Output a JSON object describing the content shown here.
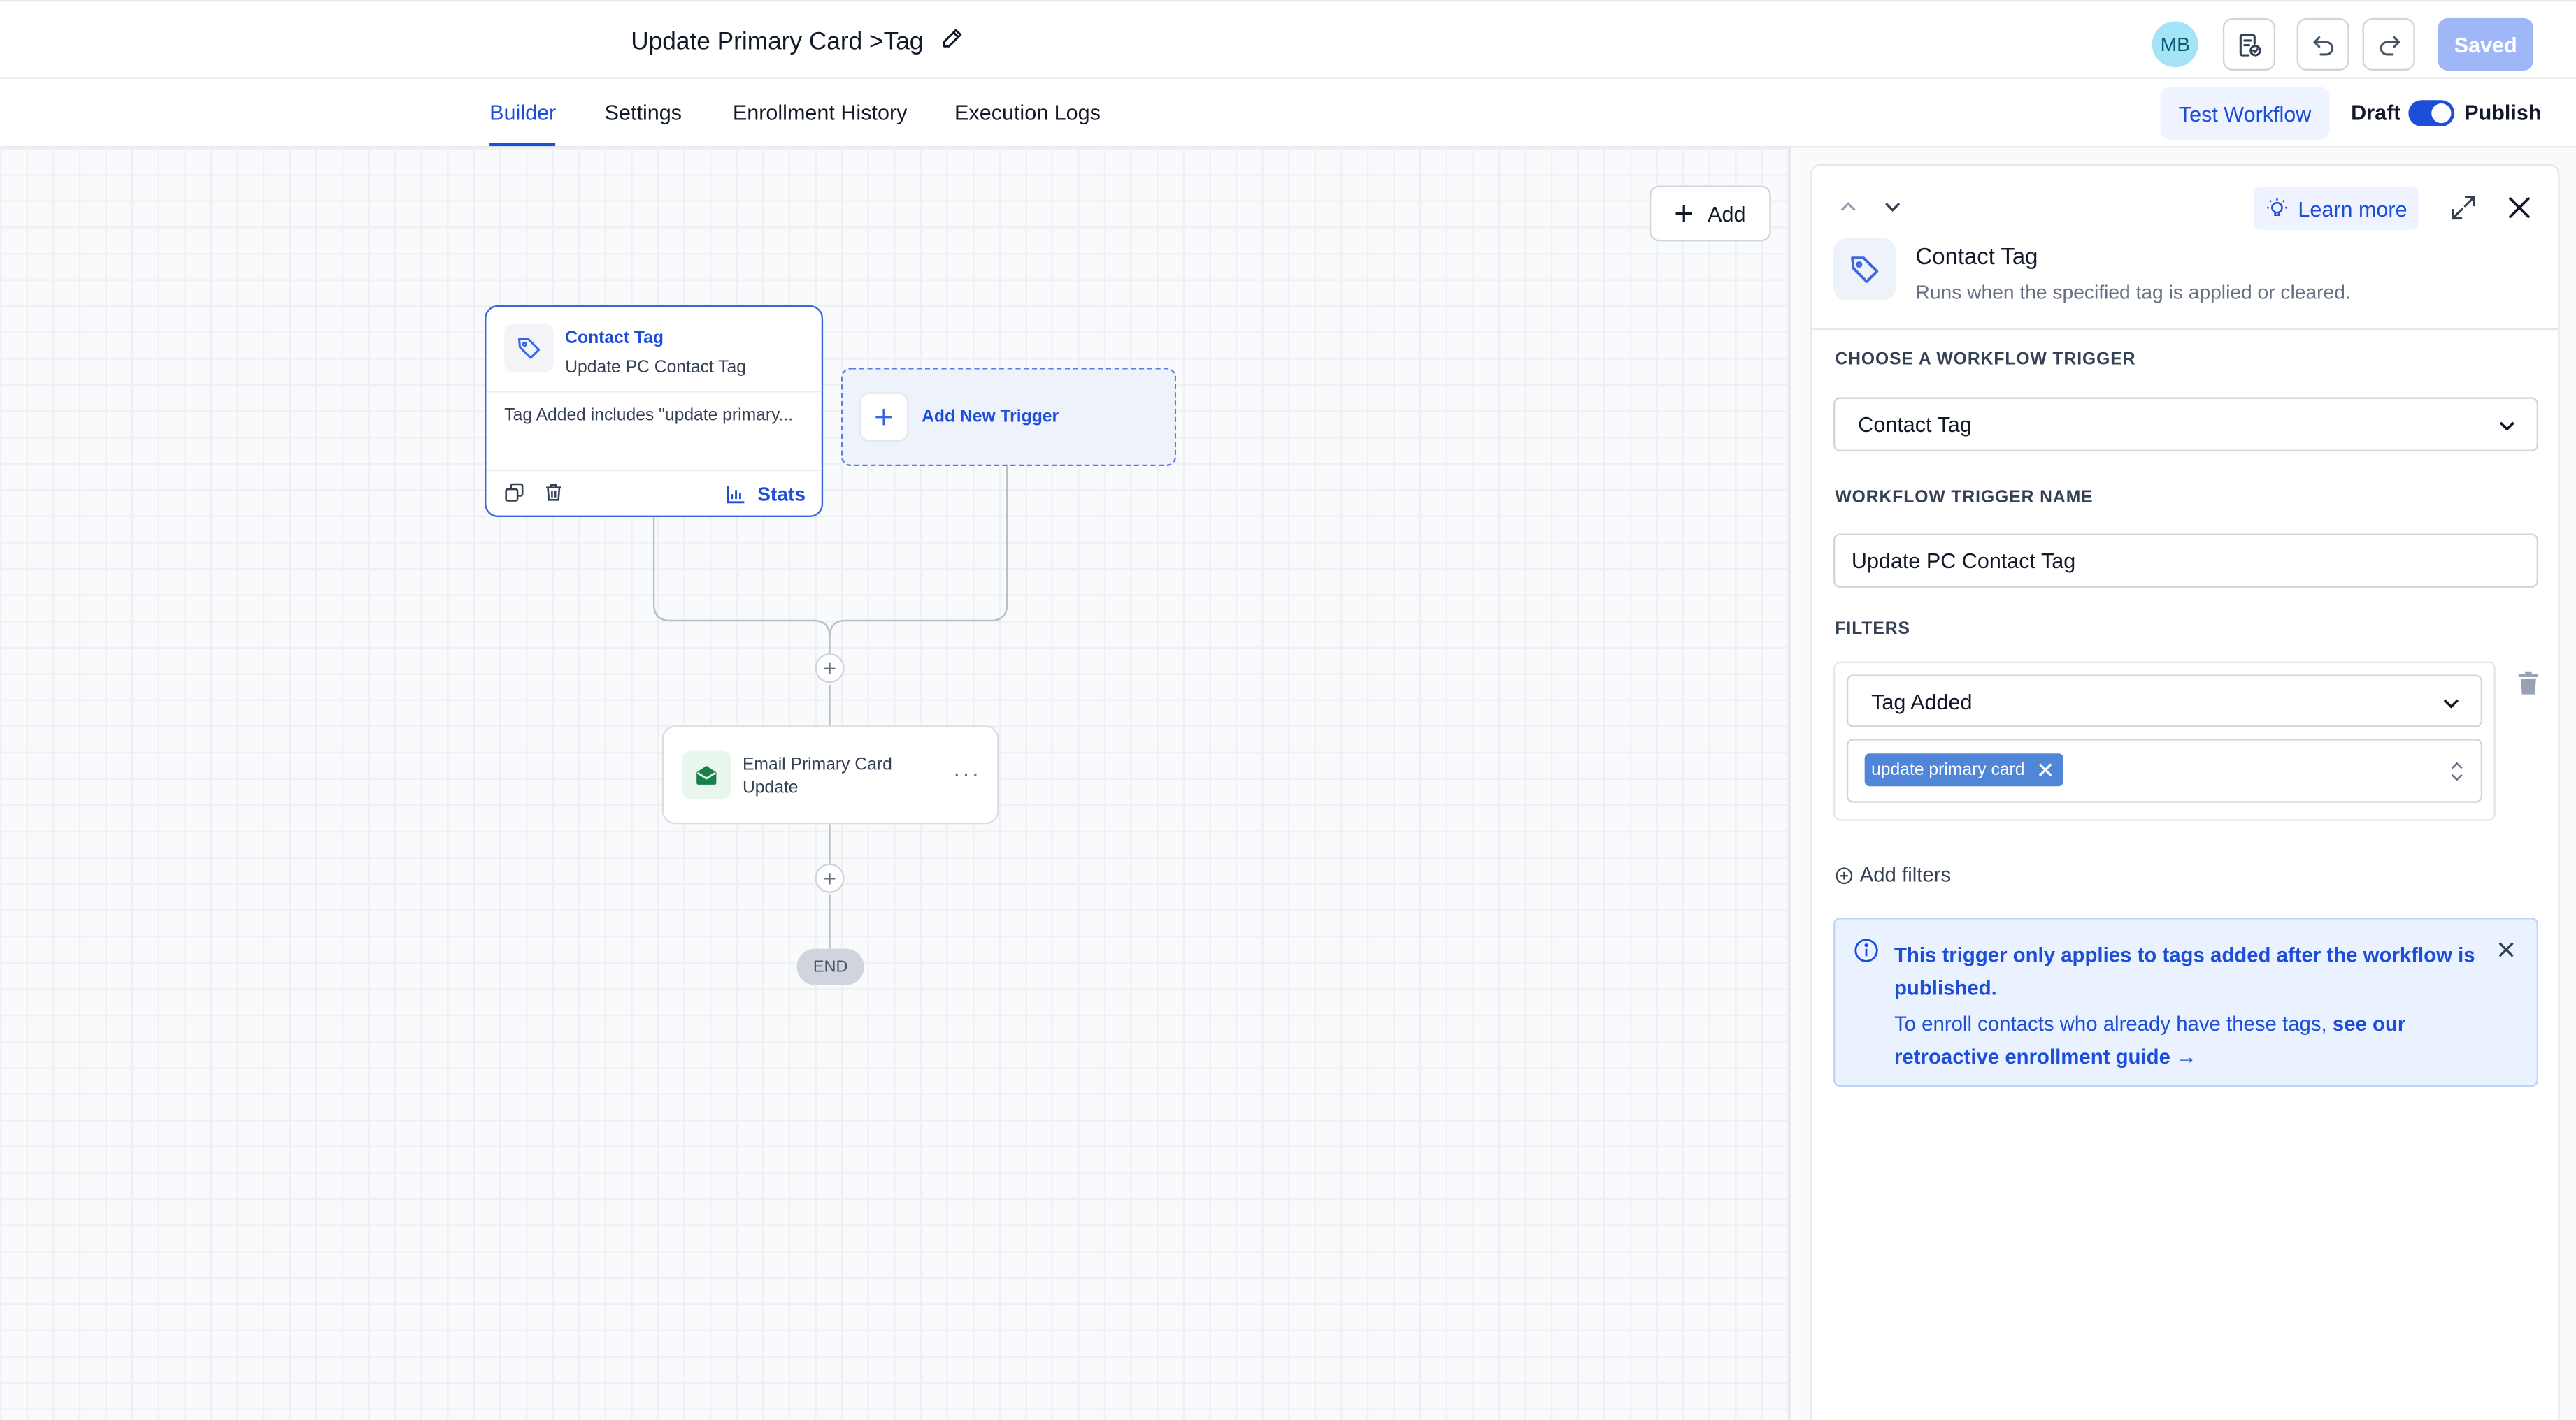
{
  "header": {
    "workflow_title": "Update Primary Card >Tag",
    "avatar_initials": "MB",
    "saved_label": "Saved"
  },
  "tabs": [
    {
      "label": "Builder",
      "active": true
    },
    {
      "label": "Settings",
      "active": false
    },
    {
      "label": "Enrollment History",
      "active": false
    },
    {
      "label": "Execution Logs",
      "active": false
    }
  ],
  "actions": {
    "test_workflow_label": "Test Workflow",
    "draft_label": "Draft",
    "publish_label": "Publish",
    "publish_on": true
  },
  "canvas": {
    "add_label": "Add",
    "trigger_card": {
      "title": "Contact Tag",
      "subtitle": "Update PC Contact Tag",
      "description": "Tag Added includes \"update primary...",
      "stats_label": "Stats"
    },
    "add_new_trigger_label": "Add New Trigger",
    "action_card": {
      "label": "Email Primary Card Update"
    },
    "end_label": "END"
  },
  "panel": {
    "learn_more_label": "Learn more",
    "trigger_title": "Contact Tag",
    "trigger_description": "Runs when the specified tag is applied or cleared.",
    "choose_trigger_label": "CHOOSE A WORKFLOW TRIGGER",
    "choose_trigger_value": "Contact Tag",
    "trigger_name_label": "WORKFLOW TRIGGER NAME",
    "trigger_name_value": "Update PC Contact Tag",
    "filters_label": "FILTERS",
    "filter_field_value": "Tag Added",
    "filter_chip": "update primary card",
    "add_filters_label": "Add filters",
    "info": {
      "bold": "This trigger only applies to tags added after the workflow is published.",
      "text": "To enroll contacts who already have these tags, ",
      "link": "see our retroactive enrollment guide →"
    }
  },
  "colors": {
    "accent": "#1d4ed8",
    "saved_button": "#9fb6f7",
    "chip": "#4f86d8",
    "info_bg": "#eaf2ff"
  }
}
